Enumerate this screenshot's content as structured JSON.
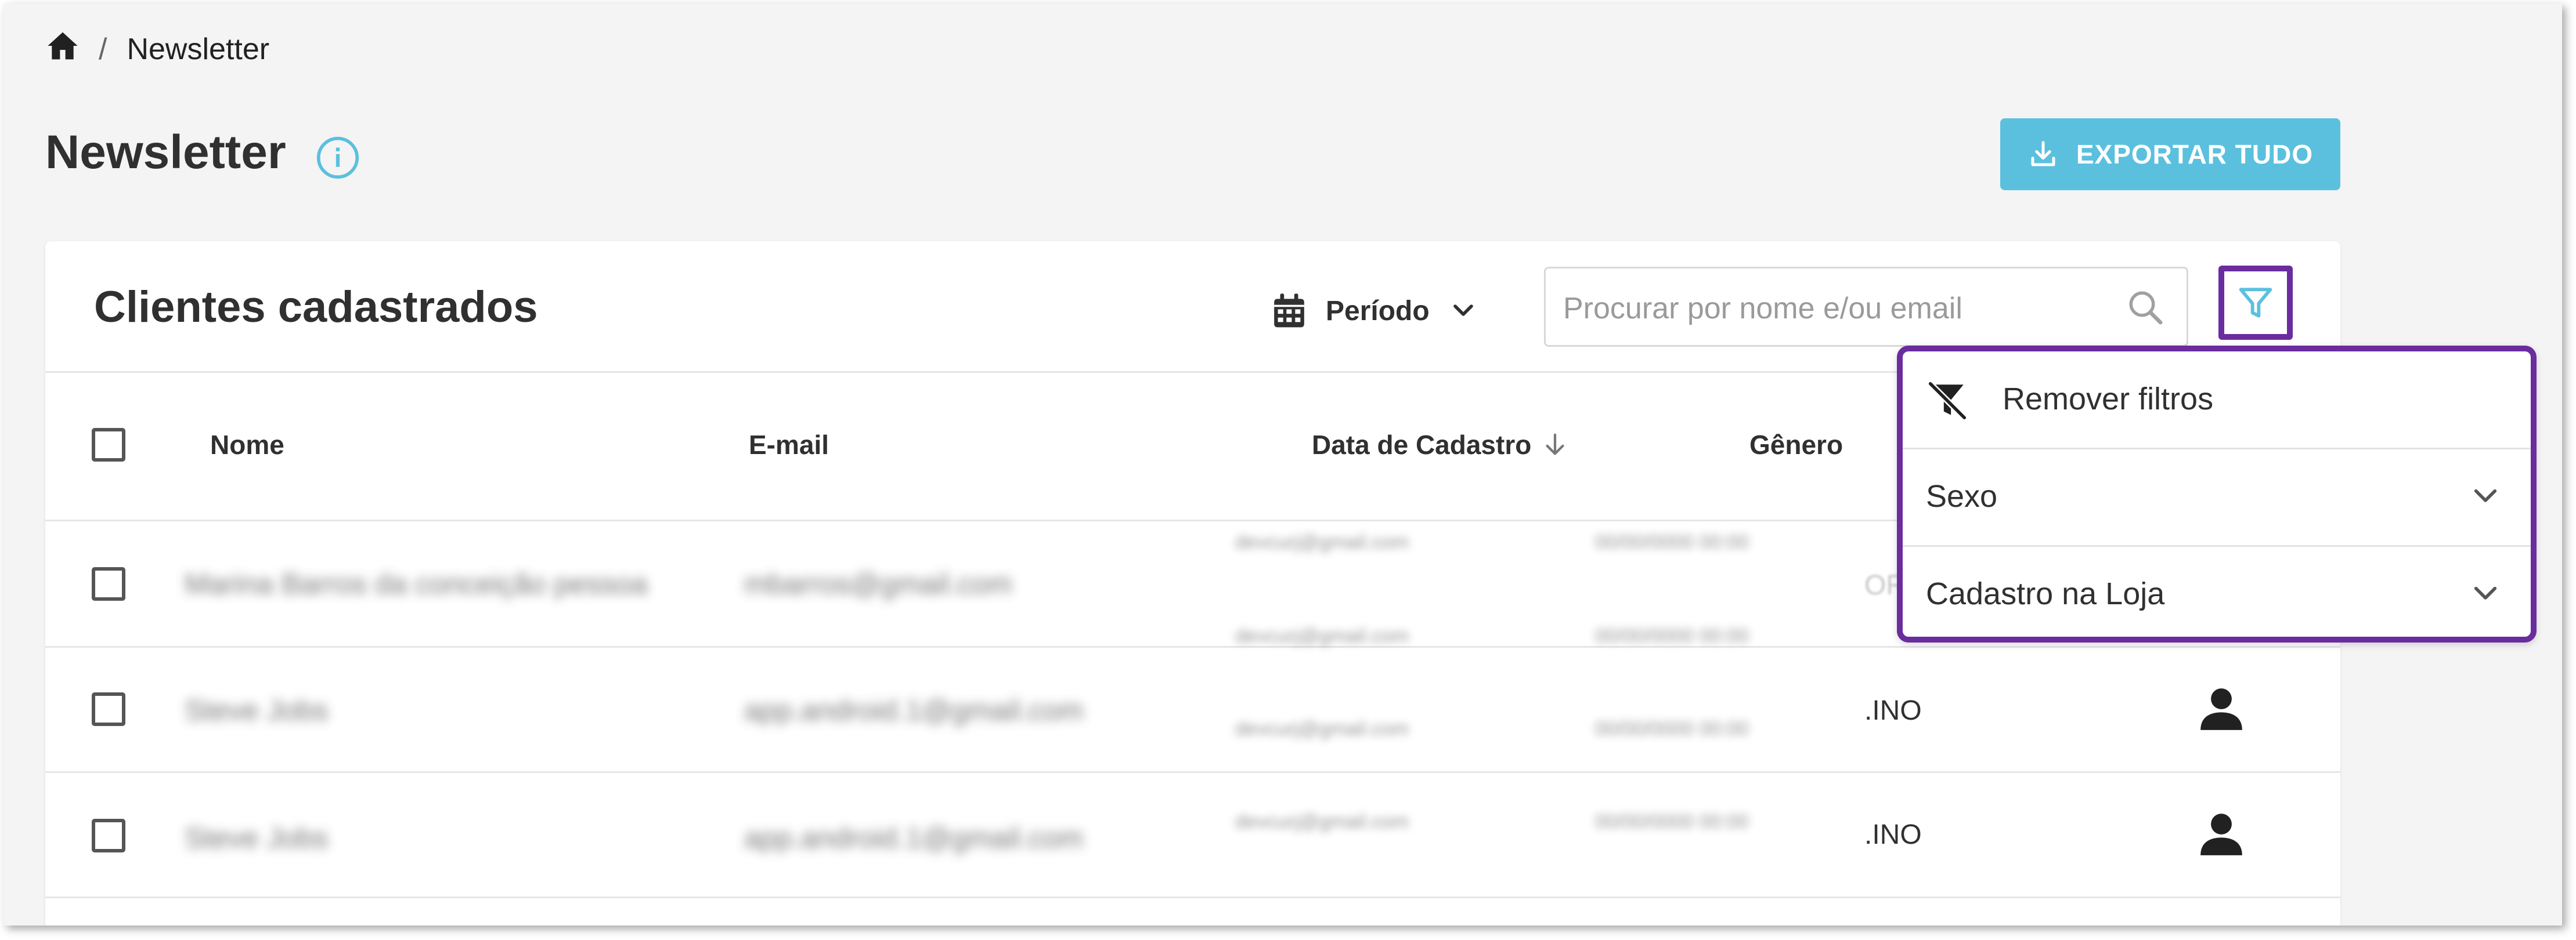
{
  "breadcrumb": {
    "separator": "/",
    "current": "Newsletter"
  },
  "page": {
    "title": "Newsletter",
    "export_label": "EXPORTAR TUDO"
  },
  "card": {
    "title": "Clientes cadastrados",
    "period_label": "Período",
    "search_placeholder": "Procurar por nome e/ou email"
  },
  "table": {
    "columns": {
      "name": "Nome",
      "email": "E-mail",
      "date": "Data de Cadastro",
      "gender": "Gênero"
    },
    "rows": [
      {
        "name": "Marina Barros da conceição pessoa",
        "email": "mbarros@gmail.com",
        "gender": "ORI"
      },
      {
        "name": "Steve Jobs",
        "email": "app.android.1@gmail.com",
        "gender": ".INO"
      },
      {
        "name": "Steve Jobs",
        "email": "app.android.1@gmail.com",
        "gender": ".INO"
      }
    ],
    "overlay_emails": [
      "devcurj@gmail.com",
      "devcurj@gmail.com",
      "devcurj@gmail.com",
      "devcurj@gmail.com"
    ],
    "overlay_dates": [
      "00/00/0000 00:00",
      "00/00/0000 00:00",
      "00/00/0000 00:00",
      "00/00/0000 00:00"
    ]
  },
  "filter_menu": {
    "remove_label": "Remover filtros",
    "sex_label": "Sexo",
    "store_label": "Cadastro na Loja"
  },
  "colors": {
    "accent": "#5bc0de",
    "highlight": "#6a2c9e"
  }
}
